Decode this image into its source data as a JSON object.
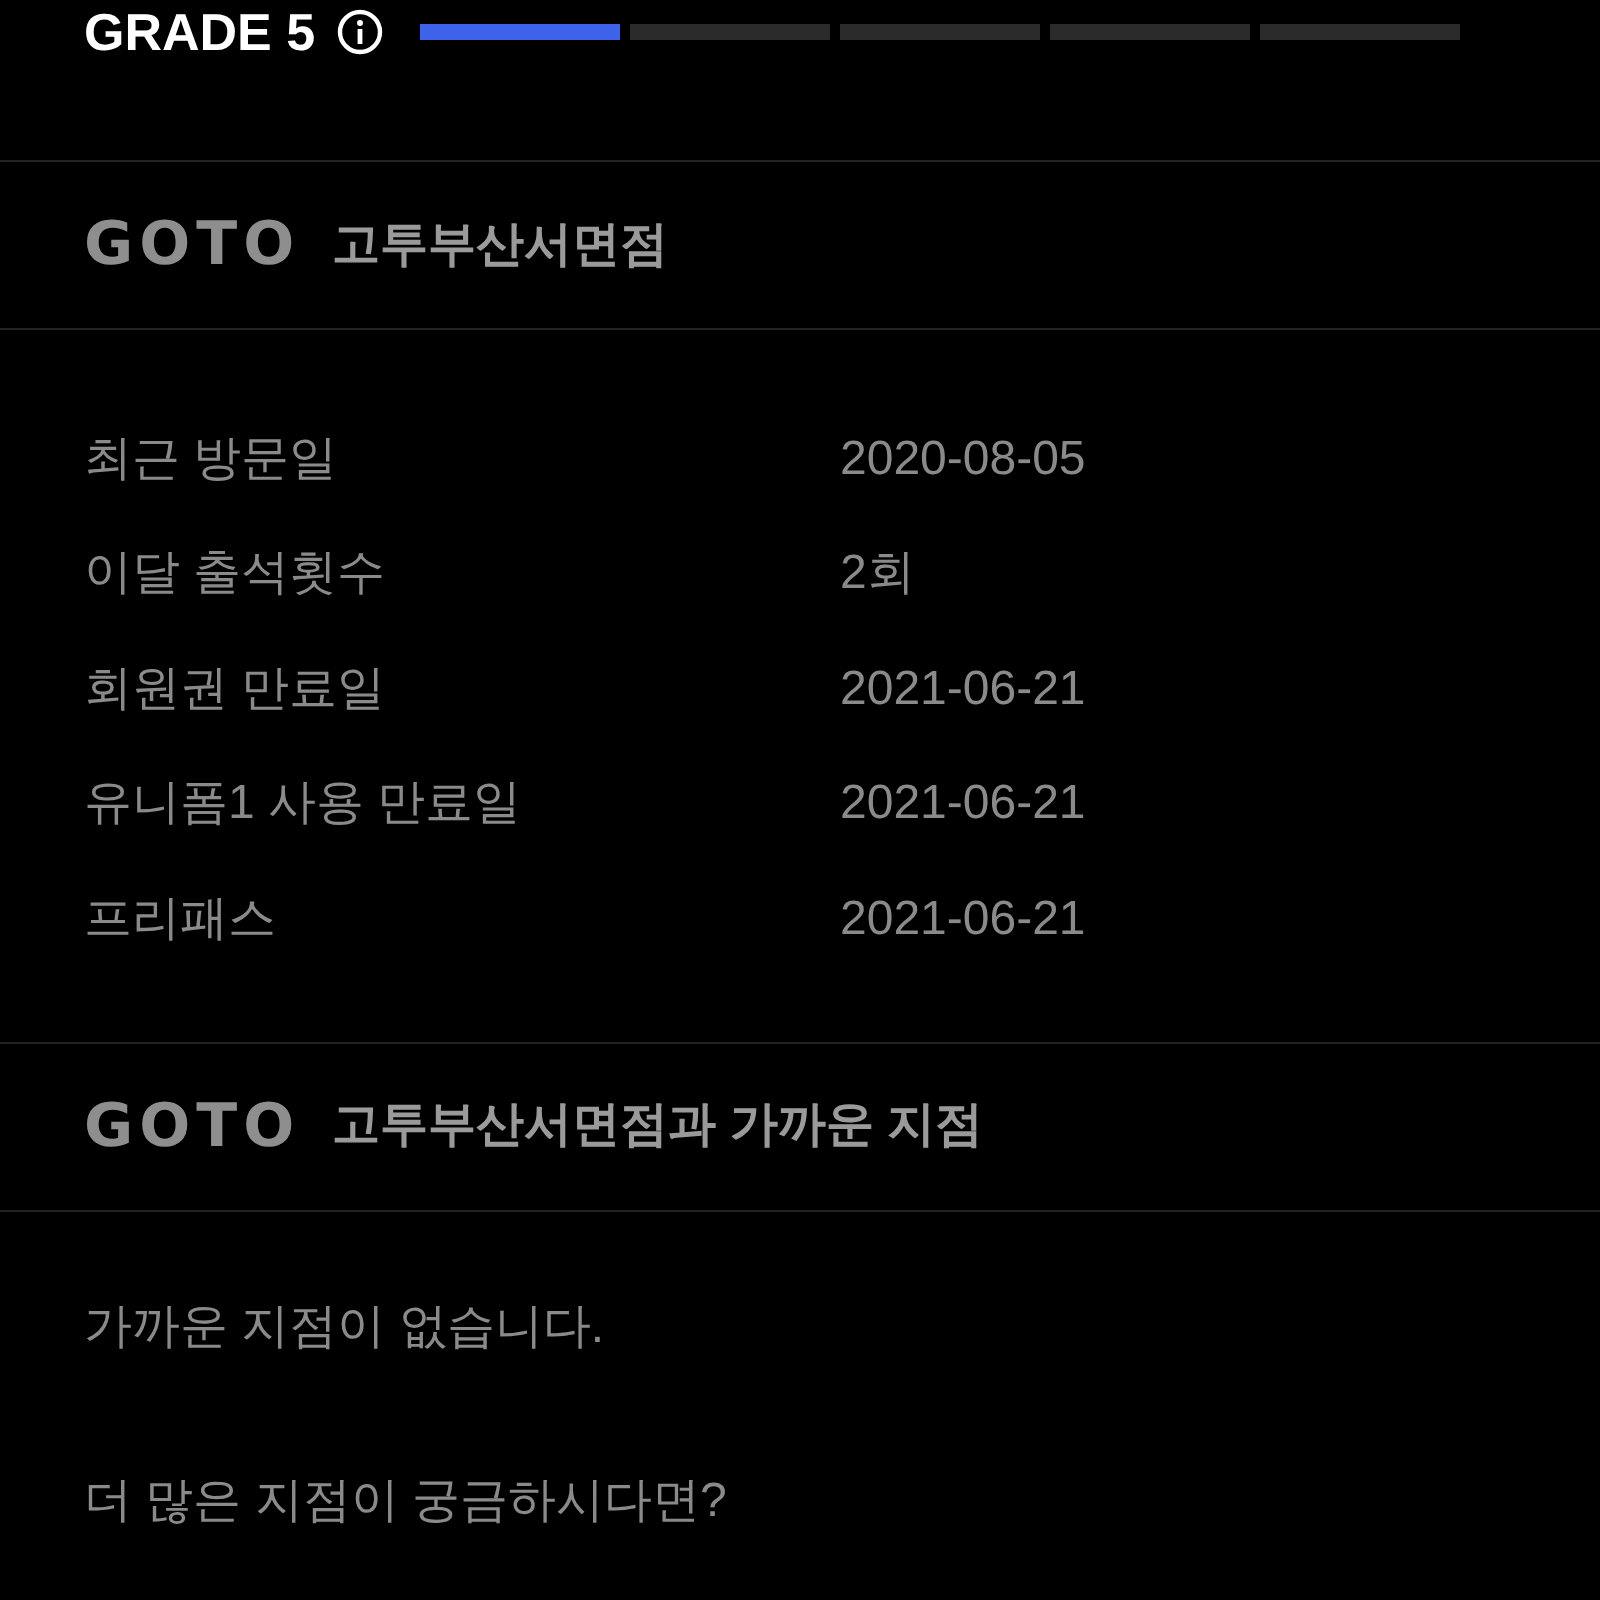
{
  "grade": {
    "label": "GRADE 5",
    "segments": [
      {
        "filled": true
      },
      {
        "filled": false
      },
      {
        "filled": false
      },
      {
        "filled": false
      },
      {
        "filled": false
      }
    ]
  },
  "branch": {
    "logo": "GOTO",
    "name": "고투부산서면점"
  },
  "details": [
    {
      "label": "최근 방문일",
      "value": "2020-08-05"
    },
    {
      "label": "이달 출석횟수",
      "value": "2회"
    },
    {
      "label": "회원권 만료일",
      "value": "2021-06-21"
    },
    {
      "label": "유니폼1 사용 만료일",
      "value": "2021-06-21"
    },
    {
      "label": "프리패스",
      "value": "2021-06-21"
    }
  ],
  "nearby": {
    "logo": "GOTO",
    "title": "고투부산서면점과 가까운 지점",
    "message": "가까운 지점이 없습니다.",
    "prompt": "더 많은 지점이 궁금하시다면?"
  }
}
